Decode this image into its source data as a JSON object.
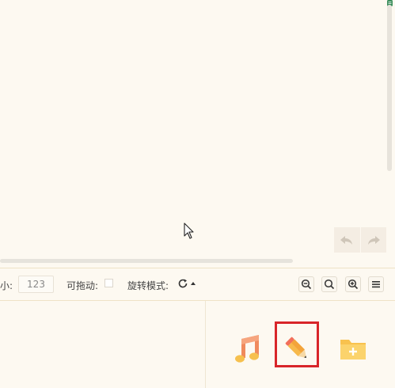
{
  "canvas": {
    "undo_icon": "undo-arrow-icon",
    "redo_icon": "redo-arrow-icon"
  },
  "toolbar": {
    "size_label": "大小:",
    "size_value": "123",
    "draggable_label": "可拖动:",
    "draggable_checked": false,
    "rotate_label": "旋转模式:",
    "rotate_icon": "rotate-cw-icon",
    "zoom_out_icon": "zoom-out-icon",
    "zoom_reset_icon": "zoom-reset-icon",
    "zoom_in_icon": "zoom-in-icon",
    "menu_icon": "hamburger-menu-icon"
  },
  "tools": [
    {
      "name": "music-note-icon",
      "color": "#f08a5d"
    },
    {
      "name": "pencil-icon",
      "color": "#f7b94b",
      "selected": true
    },
    {
      "name": "folder-add-icon",
      "color": "#f8c24e"
    }
  ],
  "colors": {
    "background": "#fdf9f1",
    "border": "#efe3c6",
    "selection": "#d8252a"
  }
}
